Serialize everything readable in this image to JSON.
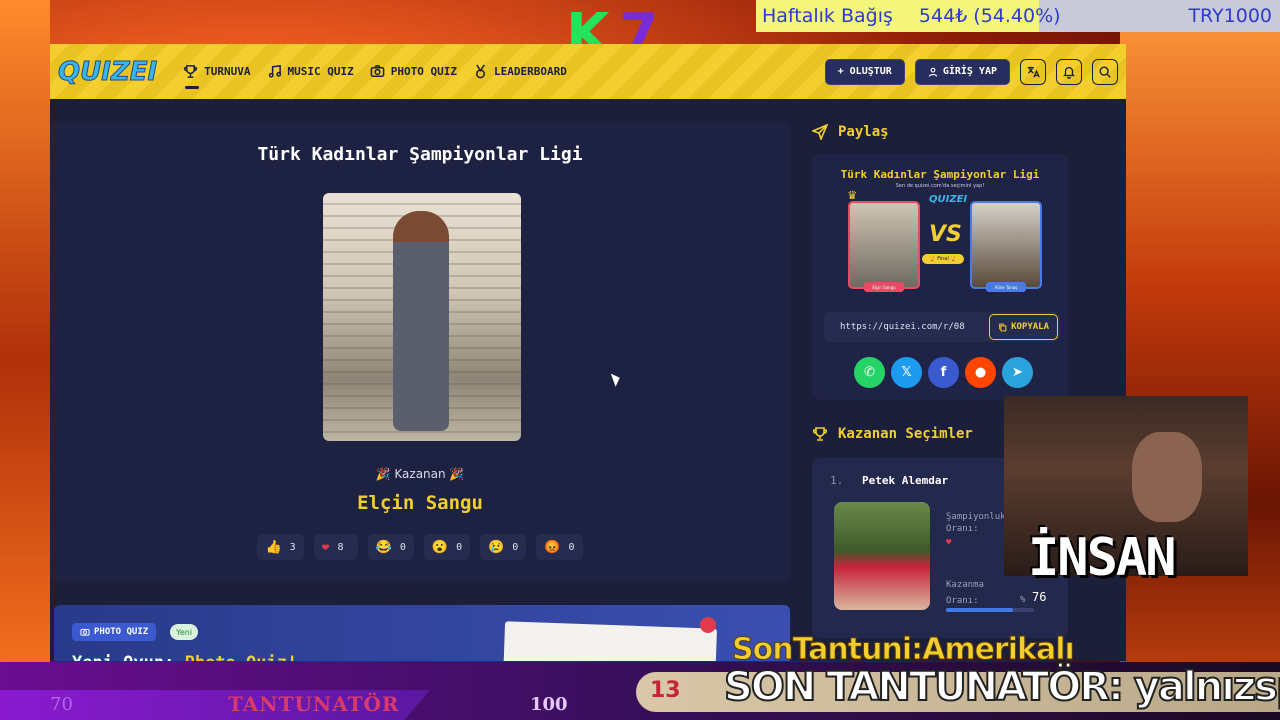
{
  "overlay": {
    "k7_left": "K",
    "k7_right": "7",
    "donation_label": "Haftalık Bağış",
    "donation_value": "544₺ (54.40%)",
    "donation_currency": "TRY1000",
    "insan": "İNSAN",
    "ticker_top": "SonTantuni:Amerikalı",
    "ticker_bottom": "SON TANTUNATÖR: yalnızsp",
    "bottom_num_left": "70",
    "bottom_label": "TANTUNATÖR",
    "bottom_num_right": "100",
    "bottom_pill_num": "13"
  },
  "colors": {
    "accent_yellow": "#f2cf2e",
    "nav_dark": "#1c1f3c",
    "card_bg": "#1d2142",
    "brand_blue": "#38b6e8"
  },
  "nav": {
    "logo": "QUIZEI",
    "items": [
      {
        "label": "TURNUVA",
        "icon": "trophy-icon"
      },
      {
        "label": "MUSIC QUIZ",
        "icon": "music-icon"
      },
      {
        "label": "PHOTO QUIZ",
        "icon": "camera-icon"
      },
      {
        "label": "LEADERBOARD",
        "icon": "medal-icon"
      }
    ],
    "create_label": "+ OLUŞTUR",
    "login_label": "GİRİŞ YAP"
  },
  "quiz": {
    "title": "Türk Kadınlar Şampiyonlar Ligi",
    "winner_label": "🎉 Kazanan 🎉",
    "winner_name": "Elçin Sangu",
    "reactions": [
      {
        "emoji": "👍",
        "count": "3"
      },
      {
        "emoji": "❤",
        "count": "8"
      },
      {
        "emoji": "😂",
        "count": "0"
      },
      {
        "emoji": "😮",
        "count": "0"
      },
      {
        "emoji": "😢",
        "count": "0"
      },
      {
        "emoji": "😡",
        "count": "0"
      }
    ]
  },
  "share": {
    "heading": "Paylaş",
    "card_title": "Türk Kadınlar Şampiyonlar Ligi",
    "card_sub": "Sen de quizei.com'da seçimini yap!",
    "card_logo": "QUIZEI",
    "vs": "VS",
    "final": "🏆 Final 🏆",
    "name_a": "Elçin Sangu",
    "name_b": "Aline Tanaş",
    "link": "https://quizei.com/r/08",
    "copy_label": "KOPYALA",
    "socials": [
      "whatsapp",
      "x",
      "facebook",
      "reddit",
      "telegram"
    ]
  },
  "winners": {
    "heading": "Kazanan Seçimler",
    "rank": "1.",
    "name": "Petek Alemdar",
    "stat1_label": "Şampiyonluk",
    "stat1_label2": "Oranı:",
    "stat2_label": "Kazanma",
    "stat2_label2": "Oranı:",
    "stat2_percent_sign": "%",
    "stat2_value": "76",
    "stat2_fraction": 0.76
  },
  "promo": {
    "tag": "PHOTO QUIZ",
    "new_badge": "Yeni",
    "headline_prefix": "Yeni Oyun: ",
    "headline_highlight": "Photo Quiz!"
  }
}
